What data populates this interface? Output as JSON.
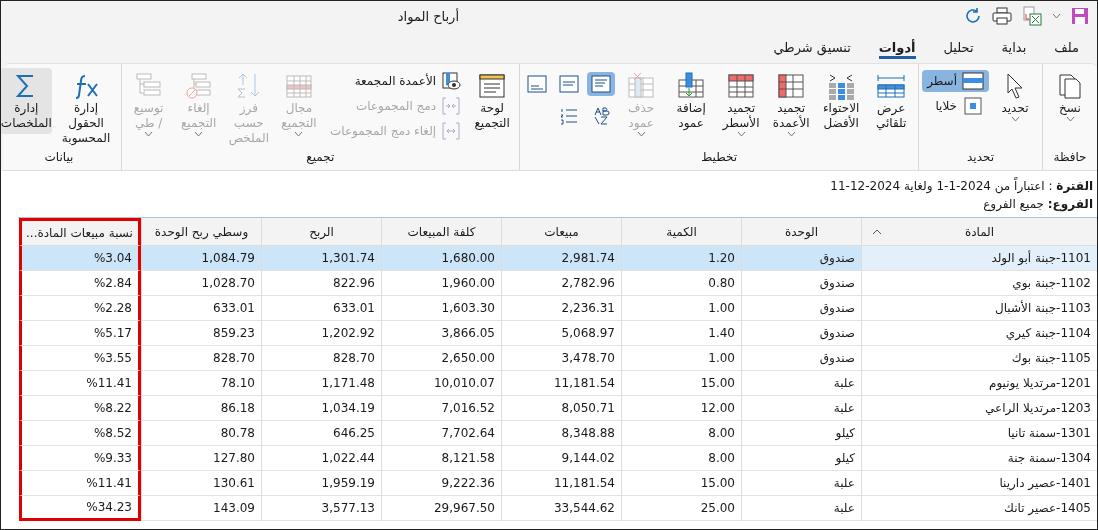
{
  "window": {
    "title": "أرباح المواد"
  },
  "quick_access": {
    "dropdown": true
  },
  "tabs": [
    {
      "label": "ملف",
      "selected": false
    },
    {
      "label": "بداية",
      "selected": false
    },
    {
      "label": "تحليل",
      "selected": false
    },
    {
      "label": "أدوات",
      "selected": true
    },
    {
      "label": "تنسيق شرطي",
      "selected": false
    }
  ],
  "ribbon": [
    {
      "label": "حافظة",
      "items": [
        {
          "kind": "large",
          "label": "نسخ",
          "dropdown": true,
          "disabled": false,
          "selected": false
        }
      ]
    },
    {
      "label": "تحديد",
      "items": [
        {
          "kind": "large",
          "label": "تحديد",
          "dropdown": true,
          "disabled": false,
          "selected": false
        },
        {
          "kind": "stack",
          "items": [
            {
              "label": "أسطر",
              "selected": true,
              "disabled": false
            },
            {
              "label": "خلايا",
              "selected": false,
              "disabled": false
            }
          ]
        }
      ]
    },
    {
      "label": "تخطيط",
      "items": [
        {
          "kind": "large",
          "label": "عرض\nتلقائي",
          "dropdown": false,
          "disabled": false,
          "selected": false
        },
        {
          "kind": "large",
          "label": "الاحتواء\nالأفضل",
          "dropdown": false,
          "disabled": false,
          "selected": false
        },
        {
          "kind": "large",
          "label": "تجميد\nالأعمدة",
          "dropdown": true,
          "disabled": false,
          "selected": false
        },
        {
          "kind": "large",
          "label": "تجميد\nالأسطر",
          "dropdown": true,
          "disabled": false,
          "selected": false
        },
        {
          "kind": "large",
          "label": "إضافة\nعمود",
          "dropdown": false,
          "disabled": false,
          "selected": false
        },
        {
          "kind": "large",
          "label": "حذف\nعمود",
          "dropdown": true,
          "disabled": true,
          "selected": false
        },
        {
          "kind": "icon_grid",
          "icons": [
            {
              "selected": true
            },
            {
              "selected": false
            },
            {
              "selected": false
            },
            {
              "selected": false
            },
            {
              "selected": false
            }
          ]
        }
      ]
    },
    {
      "label": "تجميع",
      "items": [
        {
          "kind": "large",
          "label": "لوحة\nالتجميع",
          "dropdown": false,
          "disabled": false,
          "selected": false
        },
        {
          "kind": "stack",
          "items": [
            {
              "label": "الأعمدة المجمعة",
              "selected": false,
              "disabled": false
            },
            {
              "label": "دمج المجموعات",
              "selected": false,
              "disabled": true
            },
            {
              "label": "إلغاء دمج المجموعات",
              "selected": false,
              "disabled": true
            }
          ]
        },
        {
          "kind": "large",
          "label": "مجال\nالتجميع",
          "dropdown": true,
          "disabled": true,
          "selected": false
        },
        {
          "kind": "large",
          "label": "فرز حسب\nالملخص",
          "dropdown": false,
          "disabled": true,
          "selected": false
        },
        {
          "kind": "large",
          "label": "إلغاء\nالتجميع",
          "dropdown": true,
          "disabled": true,
          "selected": false
        },
        {
          "kind": "large",
          "label": "توسيع\n/ طي",
          "dropdown": true,
          "disabled": true,
          "selected": false
        }
      ]
    },
    {
      "label": "بيانات",
      "items": [
        {
          "kind": "large",
          "label": "إدارة الحقول\nالمحسوبة",
          "dropdown": false,
          "disabled": false,
          "selected": false
        },
        {
          "kind": "large",
          "label": "إدارة\nالملخصات",
          "dropdown": false,
          "disabled": false,
          "selected": true
        }
      ]
    }
  ],
  "report_info": [
    "**الفترة** : اعتباراً من 2024-1-1 ولغاية 2024-12-11",
    "**الفروع:** جميع الفروع"
  ],
  "table": {
    "columns": [
      {
        "label": "المادة",
        "sorted": true,
        "highlighted": false
      },
      {
        "label": "الوحدة",
        "sorted": false,
        "highlighted": false
      },
      {
        "label": "الكمية",
        "sorted": false,
        "highlighted": false
      },
      {
        "label": "مبيعات",
        "sorted": false,
        "highlighted": false
      },
      {
        "label": "كلفة المبيعات",
        "sorted": false,
        "highlighted": false
      },
      {
        "label": "الربح",
        "sorted": false,
        "highlighted": false
      },
      {
        "label": "وسطي ربح الوحدة",
        "sorted": false,
        "highlighted": false
      },
      {
        "label": "نسبة مبيعات المادة...",
        "sorted": false,
        "highlighted": true
      }
    ],
    "rows": [
      {
        "selected": true,
        "cells": [
          "1101-جبنة أبو الولد",
          "صندوق",
          "1.20",
          "2,981.74",
          "1,680.00",
          "1,301.74",
          "1,084.79",
          "%3.04"
        ]
      },
      {
        "selected": false,
        "cells": [
          "1102-جبنة بوي",
          "صندوق",
          "0.80",
          "2,782.96",
          "1,960.00",
          "822.96",
          "1,028.70",
          "%2.84"
        ]
      },
      {
        "selected": false,
        "cells": [
          "1103-جبنة الأشبال",
          "صندوق",
          "1.00",
          "2,236.31",
          "1,603.30",
          "633.01",
          "633.01",
          "%2.28"
        ]
      },
      {
        "selected": false,
        "cells": [
          "1104-جبنة كيري",
          "صندوق",
          "1.40",
          "5,068.97",
          "3,866.05",
          "1,202.92",
          "859.23",
          "%5.17"
        ]
      },
      {
        "selected": false,
        "cells": [
          "1105-جبنة بوك",
          "صندوق",
          "1.00",
          "3,478.70",
          "2,650.00",
          "828.70",
          "828.70",
          "%3.55"
        ]
      },
      {
        "selected": false,
        "cells": [
          "1201-مرتديلا يونيوم",
          "علبة",
          "15.00",
          "11,181.54",
          "10,010.07",
          "1,171.48",
          "78.10",
          "%11.41"
        ]
      },
      {
        "selected": false,
        "cells": [
          "1203-مرتديلا الراعي",
          "علبة",
          "12.00",
          "8,050.71",
          "7,016.52",
          "1,034.19",
          "86.18",
          "%8.22"
        ]
      },
      {
        "selected": false,
        "cells": [
          "1301-سمنة تانيا",
          "كيلو",
          "8.00",
          "8,348.88",
          "7,702.64",
          "646.25",
          "80.78",
          "%8.52"
        ]
      },
      {
        "selected": false,
        "cells": [
          "1304-سمنة جنة",
          "كيلو",
          "8.00",
          "9,144.02",
          "8,121.58",
          "1,022.44",
          "127.80",
          "%9.33"
        ]
      },
      {
        "selected": false,
        "cells": [
          "1401-عصير دارينا",
          "علبة",
          "15.00",
          "11,181.54",
          "9,222.36",
          "1,959.19",
          "130.61",
          "%11.41"
        ]
      },
      {
        "selected": false,
        "cells": [
          "1405-عصير تانك",
          "علبة",
          "25.00",
          "33,544.62",
          "29,967.50",
          "3,577.13",
          "143.09",
          "%34.23"
        ]
      }
    ]
  }
}
